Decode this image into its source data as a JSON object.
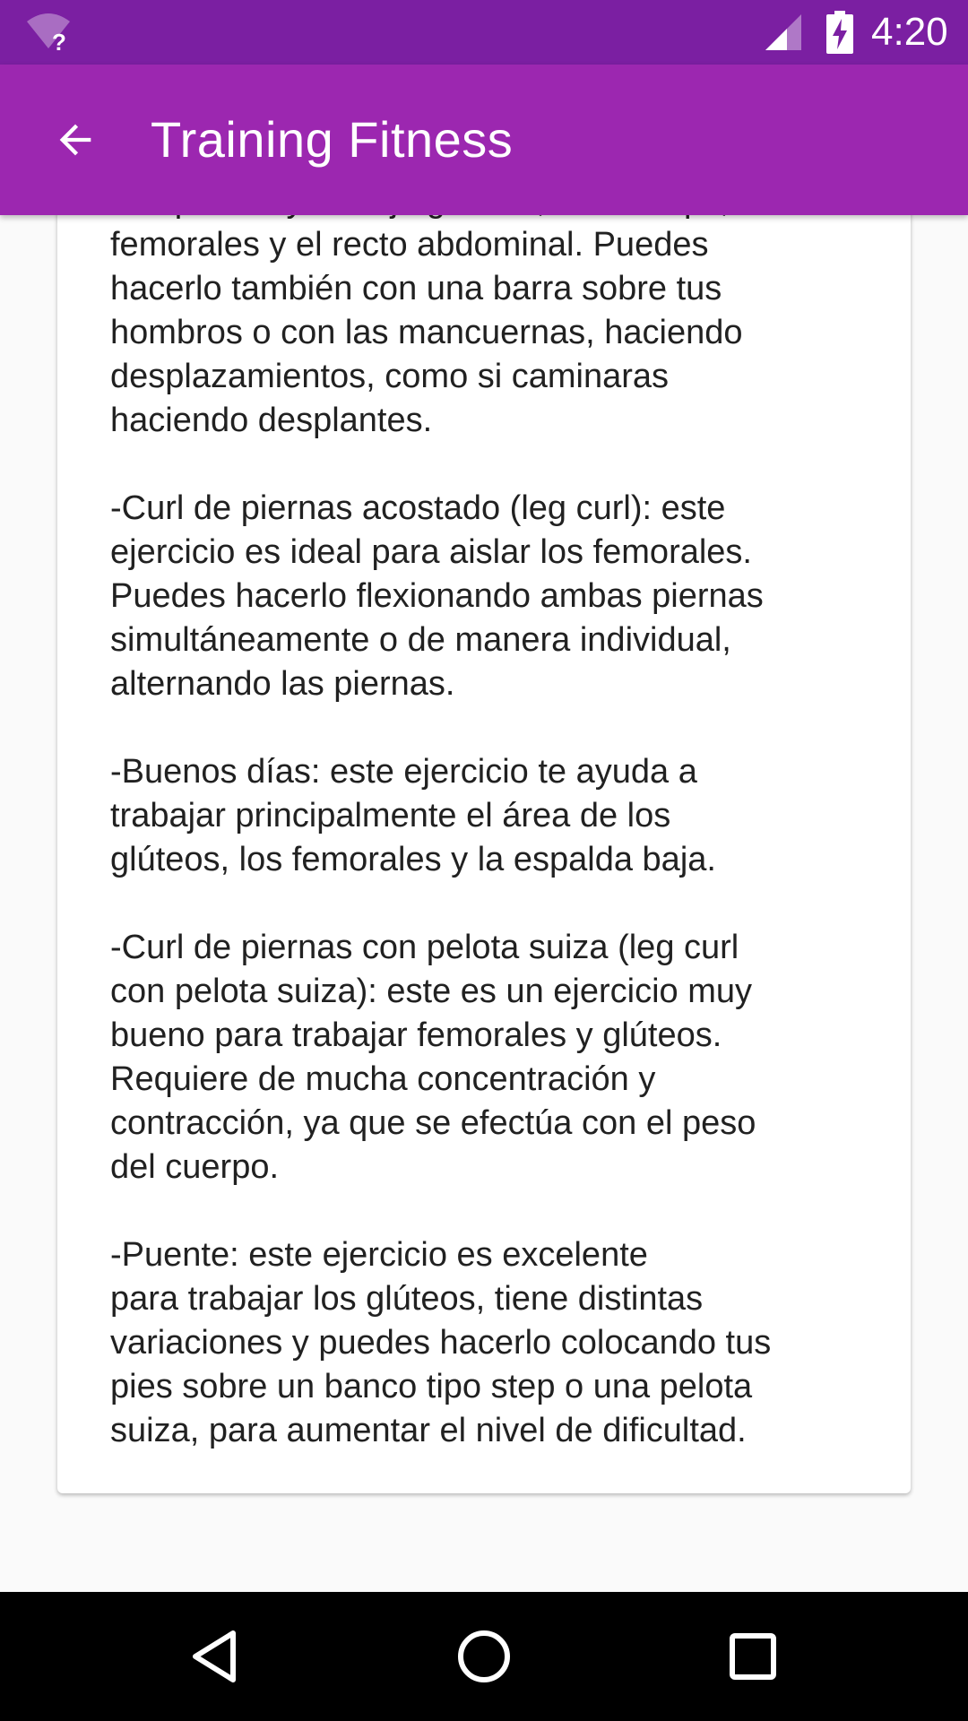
{
  "status_bar": {
    "time": "4:20",
    "wifi_icon": "wifi-unknown-icon",
    "signal_icon": "cell-signal-icon",
    "battery_icon": "battery-charging-icon"
  },
  "app_bar": {
    "title": "Training Fitness",
    "back_icon": "arrow-back-icon"
  },
  "content": {
    "text": "compuesto y trabaja glúteos, cuádriceps,\nfemorales y el recto abdominal. Puedes\nhacerlo también con una barra sobre tus\nhombros o con las mancuernas, haciendo\ndesplazamientos, como si caminaras\nhaciendo desplantes.\n\n-Curl de piernas acostado (leg curl): este\nejercicio es ideal para aislar los femorales.\nPuedes hacerlo flexionando ambas piernas\nsimultáneamente o de manera individual,\nalternando las piernas.\n\n-Buenos días: este ejercicio te ayuda a\ntrabajar principalmente el área de los\nglúteos, los femorales y la espalda baja.\n\n-Curl de piernas con pelota suiza (leg curl\ncon pelota suiza): este es un ejercicio muy\nbueno para trabajar femorales y glúteos.\nRequiere de mucha concentración y\ncontracción, ya que se efectúa con el peso\ndel cuerpo.\n\n-Puente: este ejercicio es excelente\npara trabajar los glúteos, tiene distintas\nvariaciones y puedes hacerlo colocando tus\npies sobre un banco tipo step o una pelota\nsuiza, para aumentar el nivel de dificultad."
  },
  "nav_bar": {
    "back_icon": "nav-back-icon",
    "home_icon": "nav-home-icon",
    "recents_icon": "nav-recents-icon"
  },
  "colors": {
    "status_bar": "#7b1fa2",
    "app_bar": "#9c27b0",
    "background": "#fafafa",
    "card": "#ffffff",
    "text": "#212121"
  }
}
